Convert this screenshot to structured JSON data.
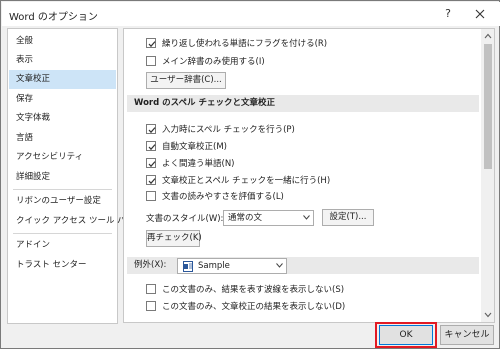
{
  "window": {
    "title": "Word のオプション",
    "help": "?",
    "close_icon": "close-icon"
  },
  "sidebar": {
    "items": [
      {
        "label": "全般"
      },
      {
        "label": "表示"
      },
      {
        "label": "文章校正",
        "selected": true
      },
      {
        "label": "保存"
      },
      {
        "label": "文字体裁"
      },
      {
        "label": "言語"
      },
      {
        "label": "アクセシビリティ"
      },
      {
        "label": "詳細設定"
      },
      {
        "label": "リボンのユーザー設定"
      },
      {
        "label": "クイック アクセス ツール バー"
      },
      {
        "label": "アドイン"
      },
      {
        "label": "トラスト センター"
      }
    ]
  },
  "content": {
    "top_checks": [
      {
        "label": "繰り返し使われる単語にフラグを付ける(R)",
        "checked": true
      },
      {
        "label": "メイン辞書のみ使用する(I)",
        "checked": false
      }
    ],
    "user_dict_button": "ユーザー辞書(C)...",
    "section_spell": "Word のスペル チェックと文章校正",
    "spell_checks": [
      {
        "label": "入力時にスペル チェックを行う(P)",
        "checked": true
      },
      {
        "label": "自動文章校正(M)",
        "checked": true
      },
      {
        "label": "よく間違う単語(N)",
        "checked": true
      },
      {
        "label": "文章校正とスペル チェックを一緒に行う(H)",
        "checked": true
      },
      {
        "label": "文書の読みやすさを評価する(L)",
        "checked": false
      }
    ],
    "style_label": "文書のスタイル(W):",
    "style_value": "通常の文",
    "settings_button": "設定(T)...",
    "recheck_button": "再チェック(K)",
    "exceptions_label": "例外(X):",
    "exceptions_value": "Sample",
    "exception_checks": [
      {
        "label": "この文書のみ、結果を表す波線を表示しない(S)",
        "checked": false
      },
      {
        "label": "この文書のみ、文章校正の結果を表示しない(D)",
        "checked": false
      }
    ]
  },
  "footer": {
    "ok": "OK",
    "cancel": "キャンセル"
  },
  "colors": {
    "selected_bg": "#cde4f7",
    "highlight_outline": "#e21a23",
    "section_bg": "#e9e9e9"
  }
}
